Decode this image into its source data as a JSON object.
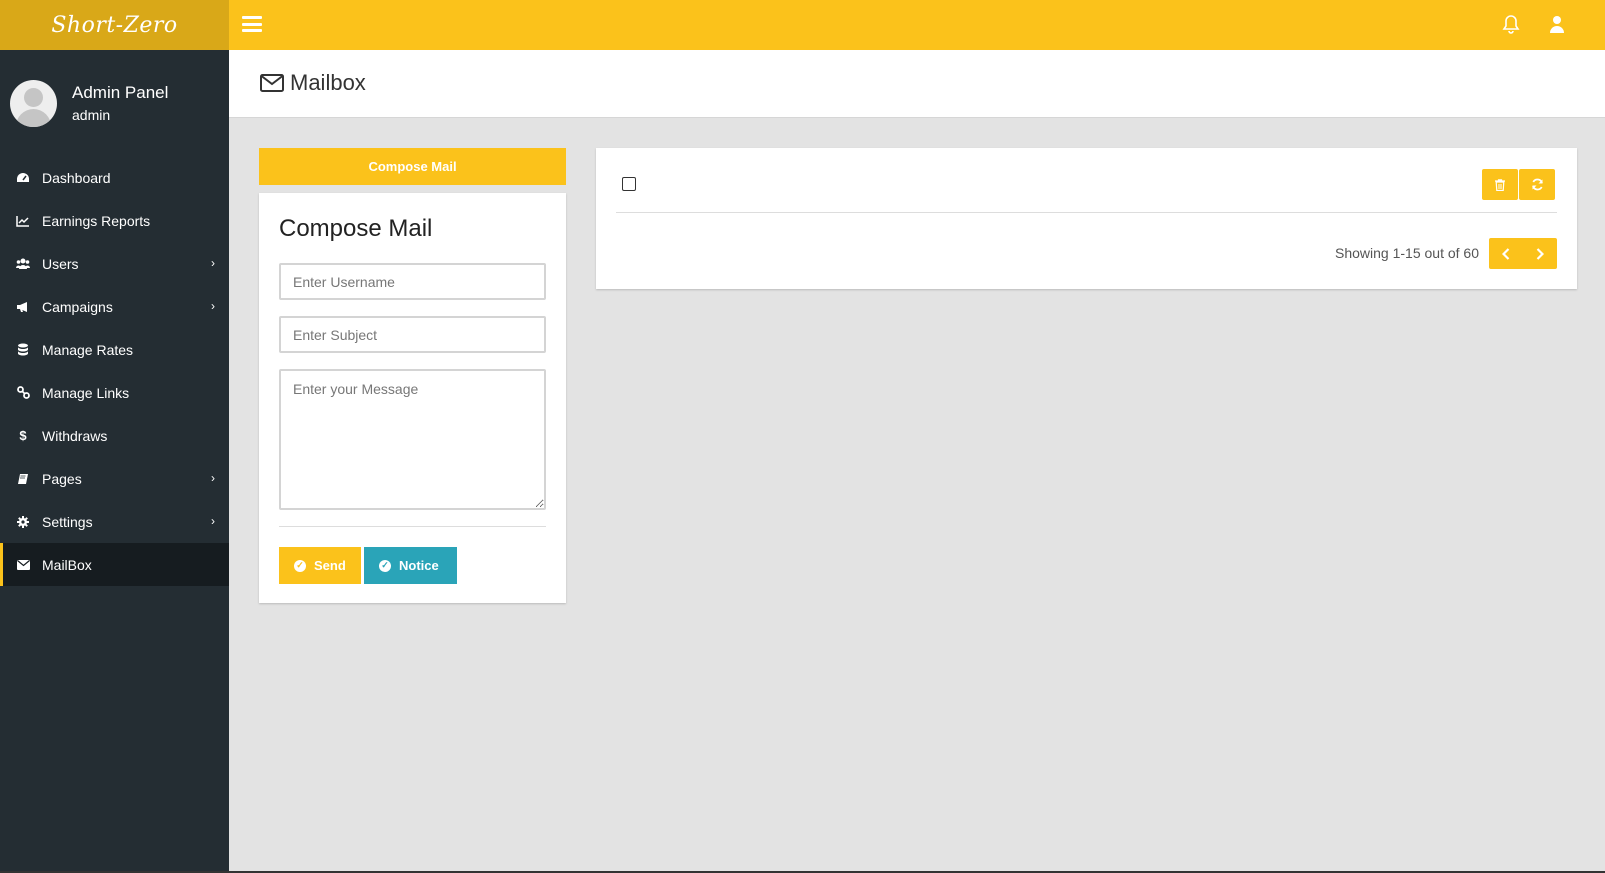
{
  "brand": "Short-Zero",
  "user": {
    "name": "Admin Panel",
    "role": "admin"
  },
  "sidebar": {
    "items": [
      {
        "label": "Dashboard",
        "icon": "dashboard-icon",
        "submenu": false
      },
      {
        "label": "Earnings Reports",
        "icon": "line-chart-icon",
        "submenu": false
      },
      {
        "label": "Users",
        "icon": "users-icon",
        "submenu": true
      },
      {
        "label": "Campaigns",
        "icon": "bullhorn-icon",
        "submenu": true
      },
      {
        "label": "Manage Rates",
        "icon": "database-icon",
        "submenu": false
      },
      {
        "label": "Manage Links",
        "icon": "link-icon",
        "submenu": false
      },
      {
        "label": "Withdraws",
        "icon": "dollar-icon",
        "submenu": false
      },
      {
        "label": "Pages",
        "icon": "book-icon",
        "submenu": true
      },
      {
        "label": "Settings",
        "icon": "gear-icon",
        "submenu": true
      },
      {
        "label": "MailBox",
        "icon": "envelope-icon",
        "submenu": false,
        "active": true
      }
    ]
  },
  "header": {
    "title": "Mailbox"
  },
  "compose": {
    "button_label": "Compose Mail",
    "heading": "Compose Mail",
    "username_placeholder": "Enter Username",
    "subject_placeholder": "Enter Subject",
    "message_placeholder": "Enter your Message",
    "send_label": "Send",
    "notice_label": "Notice"
  },
  "mail_list": {
    "showing": "Showing 1-15 out of 60"
  },
  "colors": {
    "accent": "#fbc21b",
    "brand_bg": "#d9a818",
    "sidebar_bg": "#242d33",
    "notice": "#2aa4b8"
  }
}
